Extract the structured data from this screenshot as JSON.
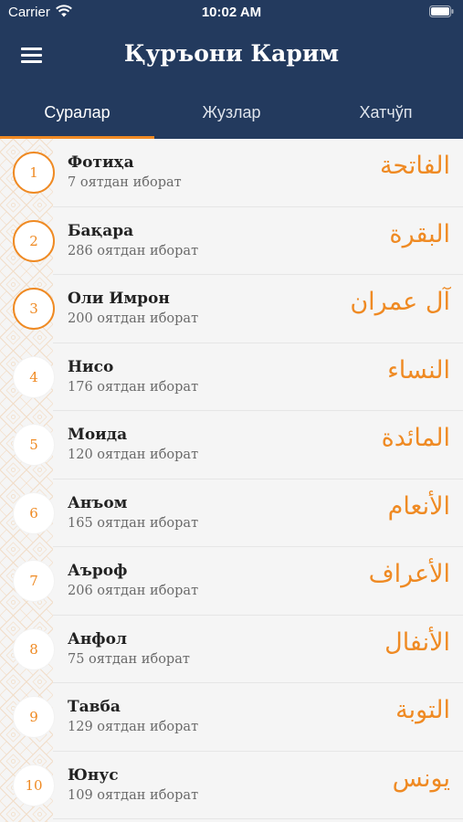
{
  "status": {
    "carrier": "Carrier",
    "time": "10:02 AM"
  },
  "nav": {
    "title": "Қуръони Карим"
  },
  "tabs": [
    {
      "label": "Суралар",
      "active": true
    },
    {
      "label": "Жузлар",
      "active": false
    },
    {
      "label": "Хатчўп",
      "active": false
    }
  ],
  "surahs": [
    {
      "number": "1",
      "name": "Фотиҳа",
      "count": "7 оятдан иборат",
      "arabic": "الفاتحة"
    },
    {
      "number": "2",
      "name": "Бақара",
      "count": "286 оятдан иборат",
      "arabic": "البقرة"
    },
    {
      "number": "3",
      "name": "Оли Имрон",
      "count": "200 оятдан иборат",
      "arabic": "آل عمران"
    },
    {
      "number": "4",
      "name": "Нисо",
      "count": "176 оятдан иборат",
      "arabic": "النساء"
    },
    {
      "number": "5",
      "name": "Моида",
      "count": "120 оятдан иборат",
      "arabic": "المائدة"
    },
    {
      "number": "6",
      "name": "Анъом",
      "count": "165 оятдан иборат",
      "arabic": "الأنعام"
    },
    {
      "number": "7",
      "name": "Аъроф",
      "count": "206 оятдан иборат",
      "arabic": "الأعراف"
    },
    {
      "number": "8",
      "name": "Анфол",
      "count": "75 оятдан иборат",
      "arabic": "الأنفال"
    },
    {
      "number": "9",
      "name": "Тавба",
      "count": "129 оятдан иборат",
      "arabic": "التوبة"
    },
    {
      "number": "10",
      "name": "Юнус",
      "count": "109 оятдан иборат",
      "arabic": "يونس"
    }
  ],
  "colors": {
    "header": "#233a5e",
    "accent": "#ef8a23"
  },
  "icons": {
    "menu": "hamburger-menu-icon",
    "wifi": "wifi-icon",
    "battery": "battery-icon"
  }
}
